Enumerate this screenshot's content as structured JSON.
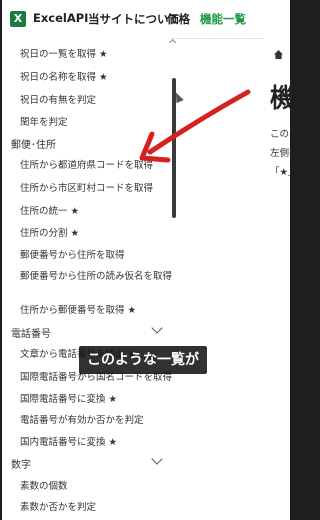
{
  "header": {
    "brand": "ExcelAPI",
    "logo_letter": "X",
    "nav": [
      "当サイトについて",
      "価格",
      "機能一覧"
    ]
  },
  "sidebar": {
    "items": [
      {
        "label": "祝日の一覧を取得 ★",
        "type": "item"
      },
      {
        "label": "祝日の名称を取得 ★",
        "type": "item"
      },
      {
        "label": "祝日の有無を判定",
        "type": "item"
      },
      {
        "label": "閏年を判定",
        "type": "item"
      },
      {
        "label": "郵便･住所",
        "type": "heading"
      },
      {
        "label": "住所から都道府県コードを取得",
        "type": "item"
      },
      {
        "label": "住所から市区町村コードを取得",
        "type": "item"
      },
      {
        "label": "住所の統一 ★",
        "type": "item"
      },
      {
        "label": "住所の分割 ★",
        "type": "item"
      },
      {
        "label": "郵便番号から住所を取得",
        "type": "item"
      },
      {
        "label": "郵便番号から住所の読み仮名を取得",
        "type": "item"
      },
      {
        "label": "住所から郵便番号を取得 ★",
        "type": "item"
      },
      {
        "label": "電話番号",
        "type": "heading"
      },
      {
        "label": "文章から電話番号を抽出 ★",
        "type": "item"
      },
      {
        "label": "国際電話番号から国名コードを取得",
        "type": "item"
      },
      {
        "label": "国際電話番号に変換 ★",
        "type": "item"
      },
      {
        "label": "電話番号が有効か否かを判定",
        "type": "item"
      },
      {
        "label": "国内電話番号に変換 ★",
        "type": "item"
      },
      {
        "label": "数字",
        "type": "heading"
      },
      {
        "label": "素数の個数",
        "type": "item"
      },
      {
        "label": "素数か否かを判定",
        "type": "item"
      }
    ]
  },
  "content": {
    "title": "機",
    "lines": [
      "このペ",
      "左側の",
      "「★」が"
    ]
  },
  "caption": "このような一覧が",
  "colors": {
    "accent_green": "#1d9a43",
    "arrow_red": "#d6221e"
  },
  "icons": [
    "excel-logo-icon",
    "home-icon",
    "chevron-down-icon",
    "cursor-icon",
    "red-arrow-annotation"
  ]
}
